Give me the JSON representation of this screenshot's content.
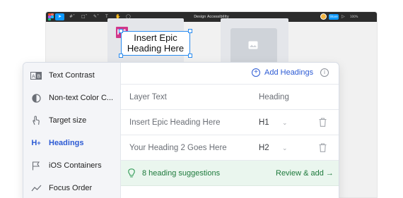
{
  "figma": {
    "file_title": "Design Accessibility",
    "share_label": "Share",
    "zoom_label": "100%",
    "canvas_badge": "H1",
    "canvas_heading_line1": "Insert Epic",
    "canvas_heading_line2": "Heading Here"
  },
  "sidebar": {
    "items": [
      {
        "label": "Text Contrast",
        "icon": "text-contrast-icon"
      },
      {
        "label": "Non-text Color C...",
        "icon": "half-circle-icon"
      },
      {
        "label": "Target size",
        "icon": "tap-hand-icon"
      },
      {
        "label": "Headings",
        "icon": "heading-icon",
        "active": true
      },
      {
        "label": "iOS Containers",
        "icon": "flag-icon"
      },
      {
        "label": "Focus Order",
        "icon": "focus-order-icon"
      }
    ]
  },
  "main": {
    "add_label": "Add Headings",
    "columns": {
      "layer": "Layer Text",
      "heading": "Heading"
    },
    "rows": [
      {
        "text": "Insert Epic Heading Here",
        "level": "H1"
      },
      {
        "text": "Your Heading 2 Goes Here",
        "level": "H2"
      }
    ],
    "suggestion_text": "8 heading suggestions",
    "suggestion_action": "Review & add →"
  },
  "colors": {
    "accent": "#2d5bd4",
    "success": "#1e7a3c",
    "badge": "#d0368a",
    "selection": "#2a8cf0"
  }
}
